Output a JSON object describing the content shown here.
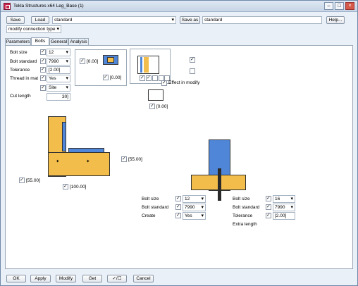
{
  "window": {
    "title": "Tekla Structures x64  Leg_Base (1)"
  },
  "toolbar": {
    "save_label": "Save",
    "load_label": "Load",
    "load_value": "standard",
    "save_as_label": "Save as",
    "save_as_value": "standard",
    "help_label": "Help...",
    "mode_value": "modify connection type"
  },
  "tabs": [
    "Parameters",
    "Bolts",
    "General",
    "Analysis"
  ],
  "bolts": {
    "size_label": "Bolt size",
    "size_value": "12",
    "standard_label": "Bolt standard",
    "standard_value": "7990",
    "tolerance_label": "Tolerance",
    "tolerance_value": "[2.00]",
    "thread_label": "Thread in mat",
    "thread_value": "Yes",
    "site_value": "Site",
    "cut_label": "Cut length",
    "cut_value": "30]"
  },
  "options": {
    "val_a": "[0.00]",
    "val_b": "[0.00]",
    "effect_label": "Effect in modify",
    "val_c": "[0.00]"
  },
  "dims": {
    "d1": "[55.00]",
    "d2": "[55.00]",
    "d3": "[100.00]"
  },
  "lower_left": {
    "size_label": "Bolt size",
    "size_value": "12",
    "standard_label": "Bolt standard",
    "standard_value": "7990",
    "create_label": "Create",
    "create_value": "Yes"
  },
  "lower_right": {
    "size_label": "Bolt size",
    "size_value": "16",
    "standard_label": "Bolt standard",
    "standard_value": "7990",
    "tolerance_label": "Tolerance",
    "tolerance_value": "[2.00]",
    "extra_label": "Extra length"
  },
  "bottom": {
    "ok_label": "OK",
    "apply_label": "Apply",
    "modify_label": "Modify",
    "get_label": "Get",
    "toggle_label": "✓/☐",
    "cancel_label": "Cancel"
  },
  "colors": {
    "orange": "#f2bd4a",
    "blue": "#4f86d7",
    "dark": "#2a2a2a"
  }
}
